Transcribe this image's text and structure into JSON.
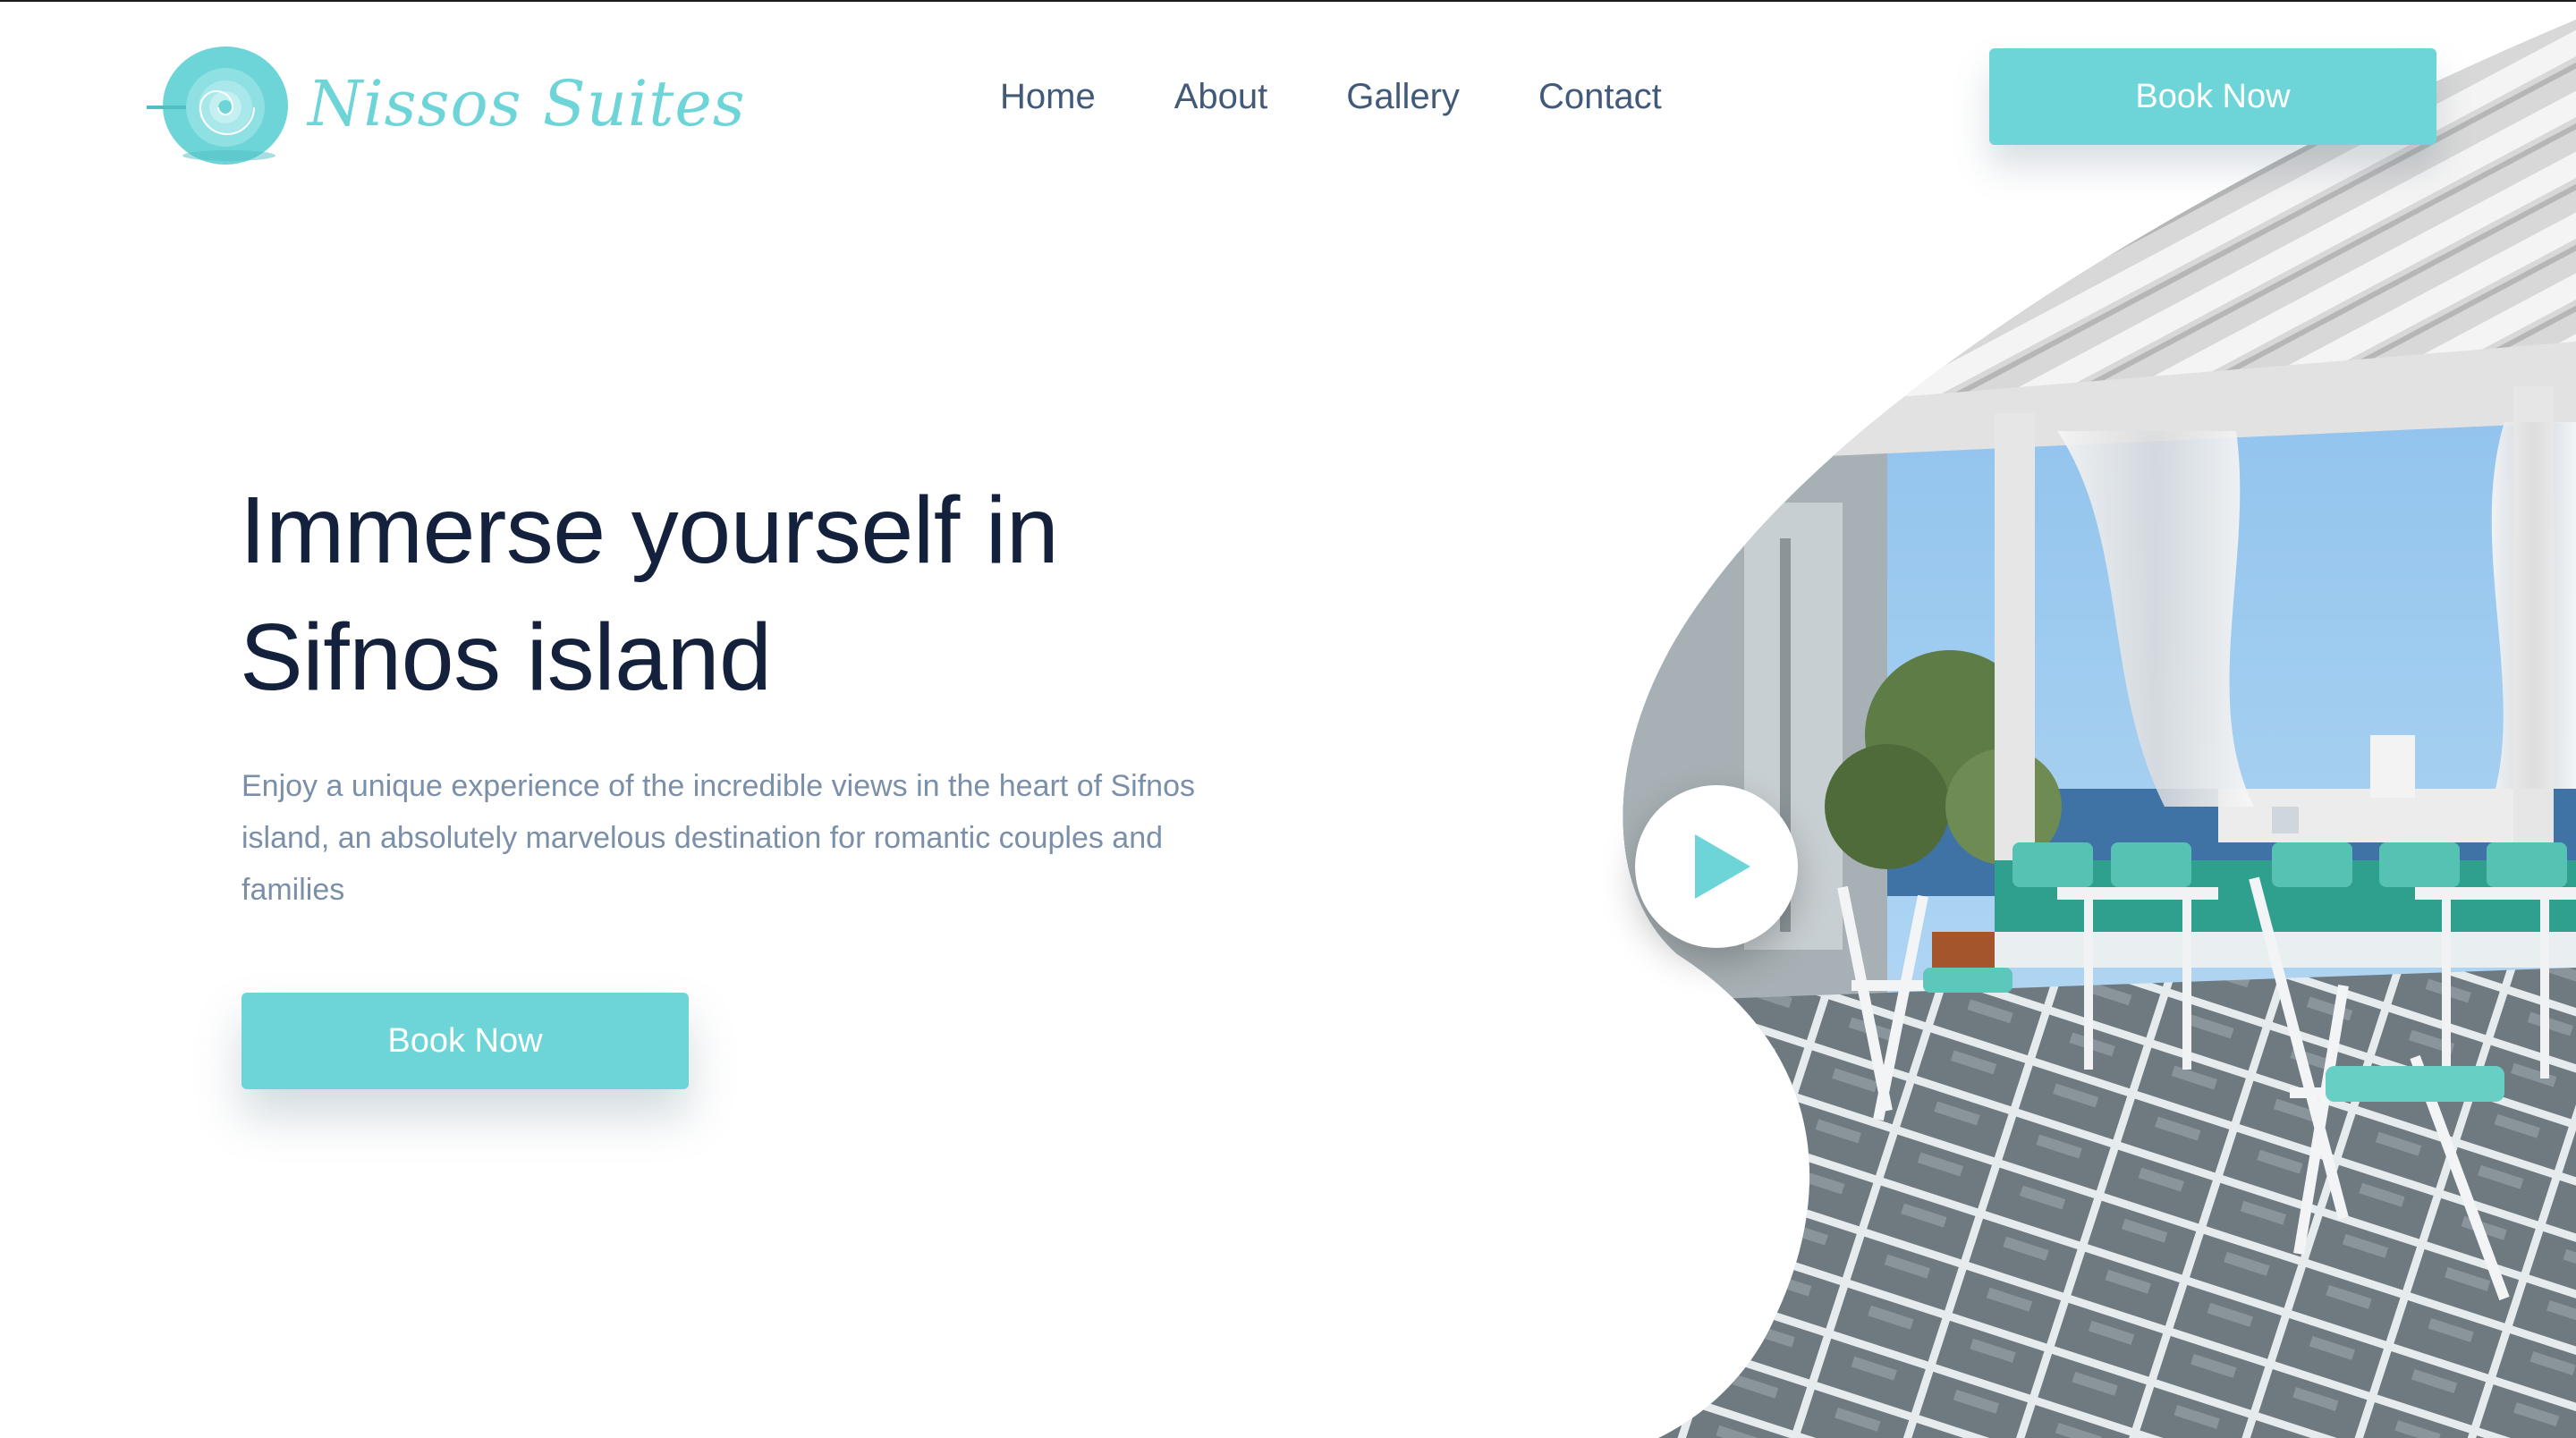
{
  "brand": {
    "name": "Nissos Suites",
    "accent_color": "#6dd5d8",
    "logo_icon": "nautilus-shell-icon"
  },
  "nav": {
    "items": [
      {
        "label": "Home"
      },
      {
        "label": "About"
      },
      {
        "label": "Gallery"
      },
      {
        "label": "Contact"
      }
    ]
  },
  "header": {
    "cta_label": "Book Now"
  },
  "hero": {
    "title_line1": "Immerse yourself in",
    "title_line2": "Sifnos island",
    "description": "Enjoy a unique experience of the incredible views in the heart of Sifnos island, an absolutely marvelous destination for romantic couples and families",
    "cta_label": "Book Now",
    "image_subject": "terrace-with-pergola-sea-view",
    "play_icon": "play-icon"
  }
}
